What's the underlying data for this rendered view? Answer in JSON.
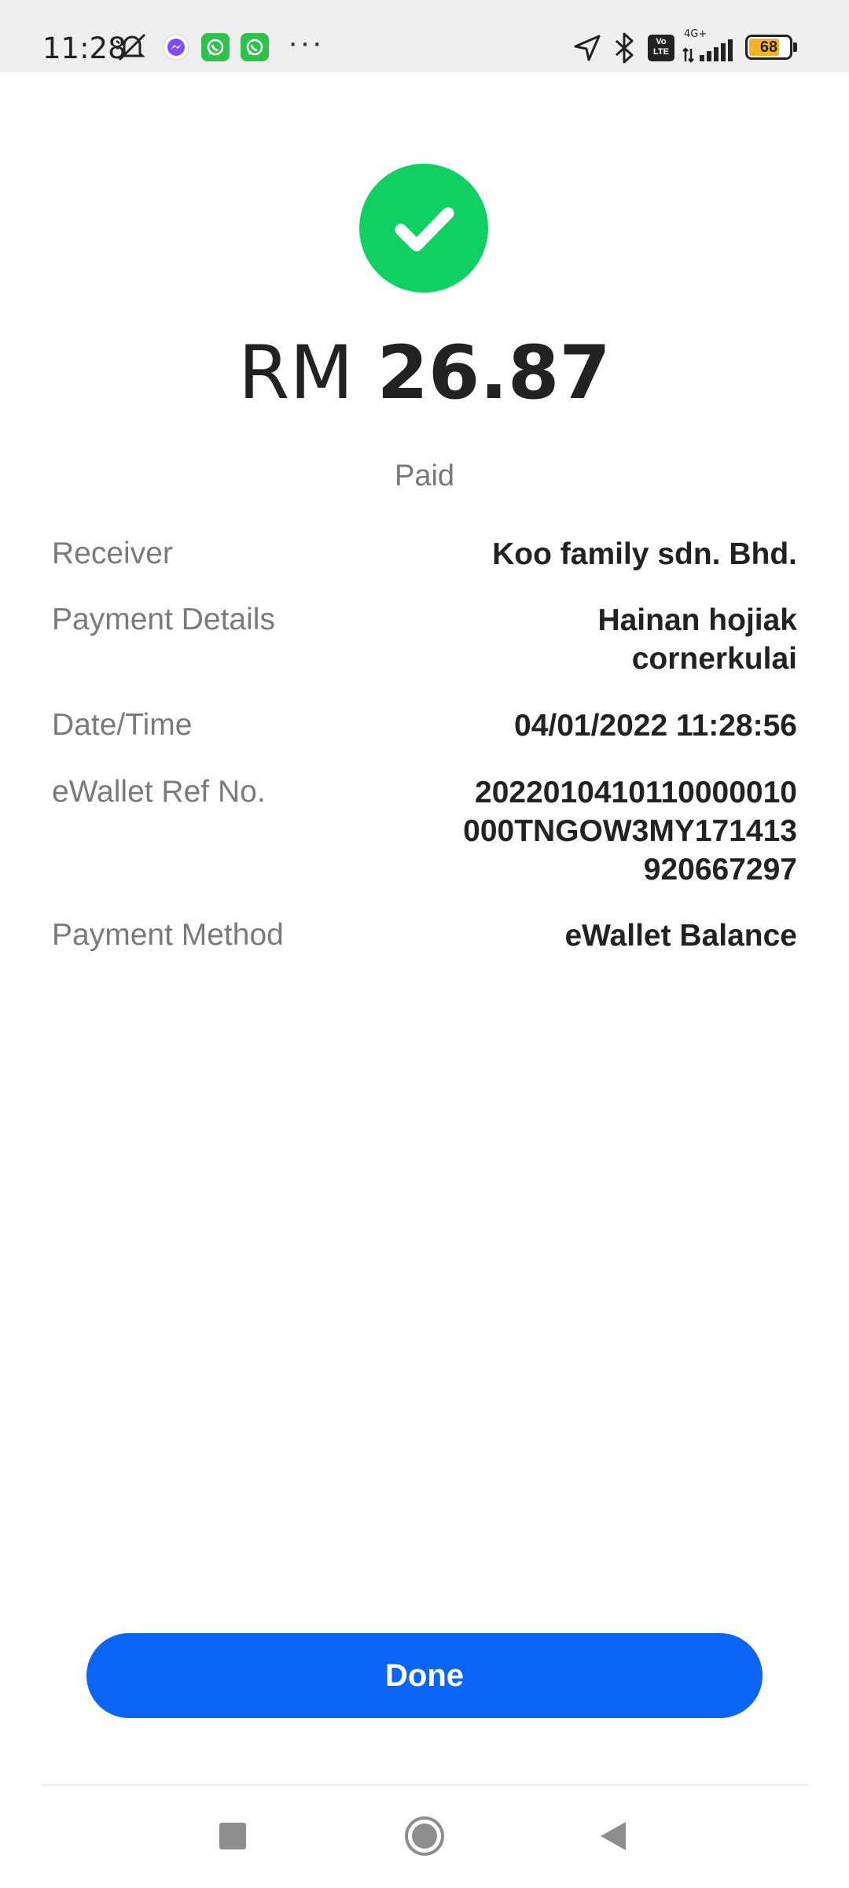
{
  "colors": {
    "accent": "#0a64f5",
    "success": "#10d063",
    "status_bar_bg": "#efefef"
  },
  "status_bar": {
    "time": "11:28",
    "icons": [
      "muted-bell-icon",
      "messenger-icon",
      "whatsapp-icon",
      "whatsapp-icon",
      "more-dots-icon",
      "location-arrow-icon",
      "bluetooth-icon",
      "volte-icon",
      "signal-4g-icon",
      "battery-icon"
    ],
    "network_label": "4G+",
    "volte_label": "Vo LTE",
    "battery_level": "68",
    "dots": "···"
  },
  "result": {
    "icon": "check-icon",
    "currency": "RM",
    "amount": "26.87",
    "status": "Paid"
  },
  "details": [
    {
      "label": "Receiver",
      "value": "Koo family sdn. Bhd."
    },
    {
      "label": "Payment Details",
      "value": "Hainan hojiak\ncornerkulai"
    },
    {
      "label": "Date/Time",
      "value": "04/01/2022 11:28:56"
    },
    {
      "label": "eWallet Ref No.",
      "value": "2022010410110000010\n000TNGOW3MY171413\n920667297"
    },
    {
      "label": "Payment Method",
      "value": "eWallet Balance"
    }
  ],
  "actions": {
    "done_label": "Done"
  },
  "nav_bar": {
    "icons": [
      "recents-square-icon",
      "home-circle-icon",
      "back-triangle-icon"
    ]
  }
}
